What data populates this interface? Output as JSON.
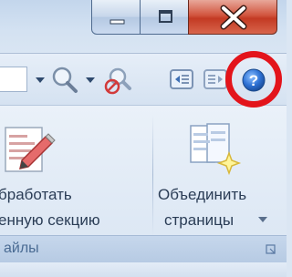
{
  "window_controls": {
    "minimize_icon": "minimize-icon",
    "maximize_icon": "maximize-icon",
    "close_glyph": "X"
  },
  "toolbar": {
    "icons": [
      "dropdown-arrow-icon",
      "zoom-icon",
      "dropdown-arrow-icon",
      "no-zoom-icon",
      "tab-left-icon",
      "tab-right-icon",
      "help-icon"
    ]
  },
  "ribbon": {
    "button1": {
      "label_line1": "бработать",
      "label_line2": "енную секцию",
      "icon": "edit-section-icon"
    },
    "button2": {
      "label_line1": "Объединить",
      "label_line2": "страницы",
      "has_dropdown": true,
      "icon": "merge-pages-icon"
    },
    "group_label": "айлы"
  },
  "annotation": {
    "color": "#e3141b",
    "target": "help-icon"
  }
}
